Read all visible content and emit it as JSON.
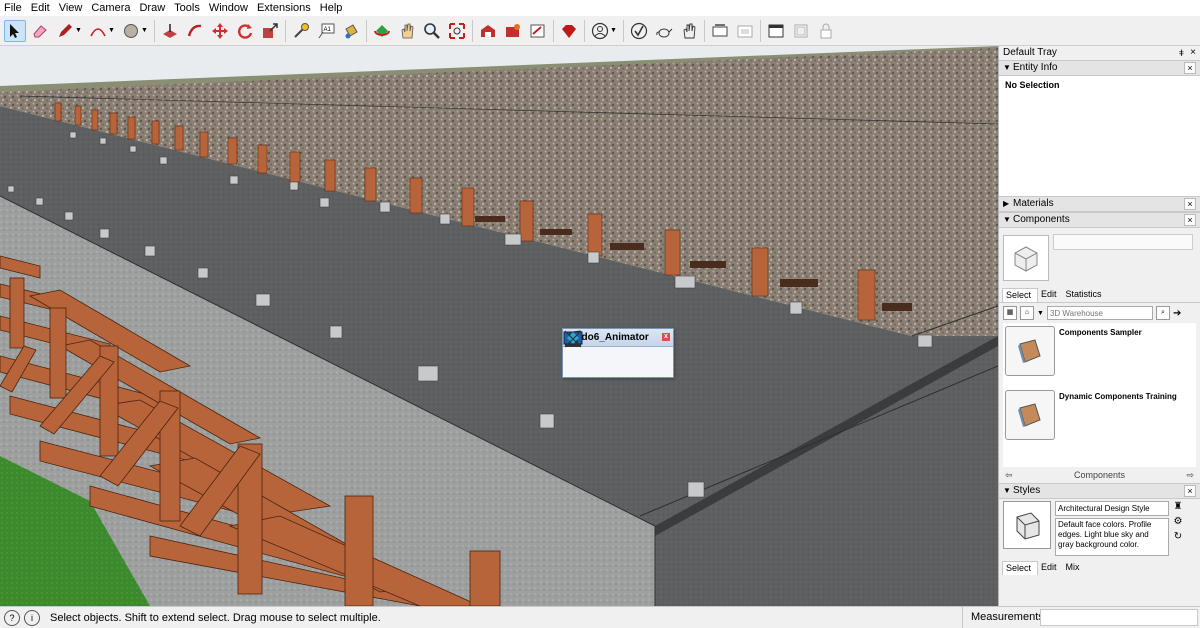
{
  "menu": [
    "File",
    "Edit",
    "View",
    "Camera",
    "Draw",
    "Tools",
    "Window",
    "Extensions",
    "Help"
  ],
  "toolbar_icons": [
    "select-icon",
    "eraser-icon",
    "pencil-icon",
    "arc-icon",
    "shape-icon",
    "push-pull-icon",
    "follow-me-icon",
    "move-icon",
    "rotate-icon",
    "scale-icon",
    "tape-measure-icon",
    "text-icon",
    "paint-bucket-icon",
    "orbit-icon",
    "pan-icon",
    "zoom-icon",
    "zoom-extents-icon",
    "warehouse-icon",
    "extension-warehouse-icon",
    "send-to-layout-icon",
    "ruby-icon",
    "profile-icon",
    "check-icon",
    "teapot-icon",
    "hand-icon",
    "section-icon",
    "section-display-icon",
    "window-icon",
    "layer-icon",
    "lock-icon"
  ],
  "fredo": {
    "title": "Fredo6_Animator",
    "close": "x",
    "icons": [
      "clapper-icon",
      "monitor-play-icon",
      "sliders-icon",
      "camera-target-icon"
    ]
  },
  "tray": {
    "title": "Default Tray",
    "pin": "ǂ",
    "close": "×",
    "entity_info": {
      "label": "Entity Info",
      "body": "No Selection"
    },
    "materials": {
      "label": "Materials"
    },
    "components": {
      "label": "Components",
      "tabs": [
        "Select",
        "Edit",
        "Statistics"
      ],
      "search_placeholder": "3D Warehouse",
      "items": [
        {
          "name": "Components Sampler"
        },
        {
          "name": "Dynamic Components Training"
        }
      ],
      "footer": "Components"
    },
    "styles": {
      "label": "Styles",
      "name": "Architectural Design Style",
      "description": "Default face colors. Profile edges. Light blue sky and gray background color.",
      "tabs": [
        "Select",
        "Edit",
        "Mix"
      ]
    }
  },
  "status": {
    "message": "Select objects. Shift to extend select. Drag mouse to select multiple.",
    "measurements_label": "Measurements",
    "measurements_value": ""
  }
}
